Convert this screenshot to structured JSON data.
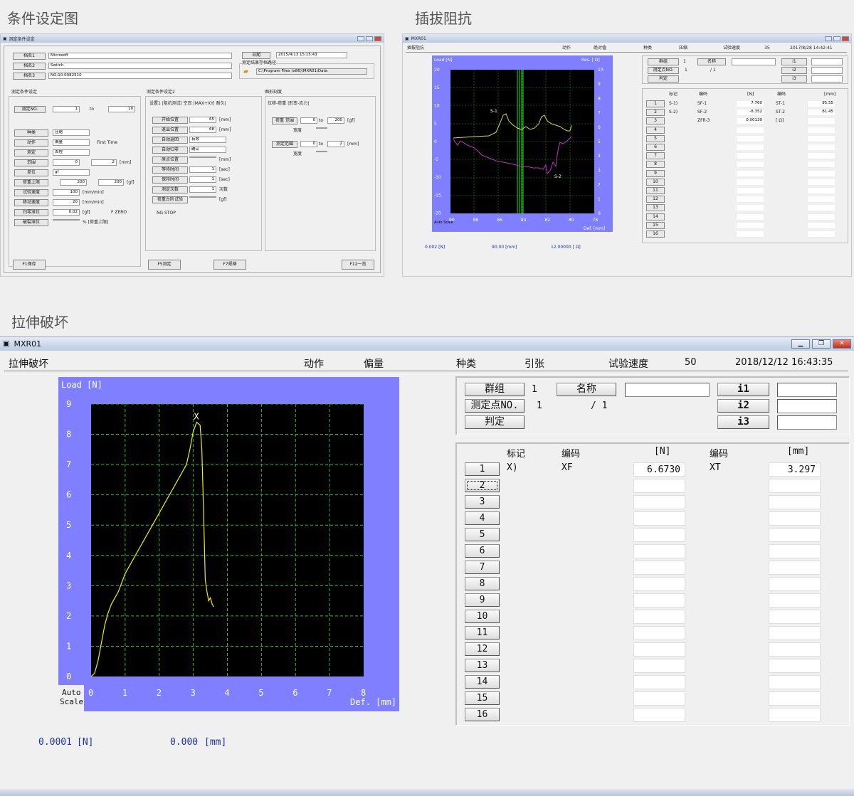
{
  "sections": {
    "top_left_title": "条件设定图",
    "top_right_title": "插拔阻抗",
    "bottom_title": "拉伸破坏"
  },
  "cond_window": {
    "title": "测定条件设定",
    "fields": [
      {
        "label": "档名1",
        "value": "Microsoft"
      },
      {
        "label": "档名2",
        "value": "Switch"
      },
      {
        "label": "档名3",
        "value": "NO:10-0082510"
      }
    ],
    "date_label": "日期",
    "date_value": "2015/4/13 15:15:43",
    "path_group": "测定结果存档路径",
    "path_value": "C:\\Program Files (x86)\\MXR01\\Data",
    "group1": "测定条件设定",
    "no_label": "测定NO.",
    "no_from": "1",
    "no_to_label": "to",
    "no_to": "10",
    "rows": [
      {
        "label": "种类",
        "value": "压缩"
      },
      {
        "label": "动作",
        "value": "偏量"
      },
      {
        "label": "测定",
        "value": "去程"
      },
      {
        "label": "范围",
        "value": "0"
      },
      {
        "label": "单位",
        "value": "gf"
      },
      {
        "label": "荷重上限",
        "value": "200"
      },
      {
        "label": "试验速度",
        "value": "100"
      },
      {
        "label": "移动速度",
        "value": "20"
      },
      {
        "label": "归零准位",
        "value": "0.02"
      },
      {
        "label": "破裂准位",
        "value": ""
      }
    ],
    "first_time": "First Time",
    "range_to": "2",
    "unit_mm": "[mm]",
    "upper_r": "200",
    "unit_gf": "[gf]",
    "speed_unit": "[mm/min]",
    "fzero": "F ZERO",
    "break_unit": "% [荷重上限]",
    "group2": "测定条件设定2",
    "tabs": "设置1 |阻抗测试| 空压 |MAX+XY| 耐久|",
    "g2rows": [
      {
        "label": "开始位置",
        "value": "65",
        "unit": "[mm]"
      },
      {
        "label": "退出位置",
        "value": "68",
        "unit": "[mm]"
      },
      {
        "label": "自动返回",
        "value": "有效",
        "unit": ""
      },
      {
        "label": "自动归零",
        "value": "确认",
        "unit": ""
      },
      {
        "label": "原点位置",
        "value": "",
        "unit": "[mm]"
      },
      {
        "label": "等待时间",
        "value": "1",
        "unit": "[sec]"
      },
      {
        "label": "保持时间",
        "value": "1",
        "unit": "[sec]"
      },
      {
        "label": "测定次数",
        "value": "1",
        "unit": "次数"
      },
      {
        "label": "荷重台阶试验",
        "value": "",
        "unit": "[gf]"
      }
    ],
    "ng_stop": "NG STOP",
    "group3": "图形刻度",
    "g3tab": "位移-荷重 |形变-应力|",
    "load_range": "荷重 范围",
    "load_from": "0",
    "load_to": "200",
    "load_unit": "[gf]",
    "width_label": "宽度",
    "meas_range": "测定范围",
    "meas_from": "0",
    "meas_to": "2",
    "meas_unit": "[mm]",
    "buttons": [
      "F1保存",
      "F5测定",
      "F7规格",
      "F12一览"
    ]
  },
  "ins_window": {
    "title": "MXR01",
    "header": [
      "插拔阻抗",
      "动作",
      "绝对值",
      "种类",
      "压缩",
      "试验速度",
      "35",
      "2017/8/28 14:42:41"
    ],
    "y_left": [
      "20",
      "15",
      "10",
      "5",
      "0",
      "-5",
      "-10",
      "-15",
      "-20"
    ],
    "y_right": [
      "10",
      "9",
      "8",
      "7",
      "6",
      "5",
      "4",
      "3",
      "2",
      "1",
      "0"
    ],
    "x_ticks": [
      "90",
      "88",
      "86",
      "84",
      "82",
      "80",
      "78"
    ],
    "load_label": "Load [N]",
    "res_label": "Res. [ Ω]",
    "def_label": "Def. [mm]",
    "auto_scale": "Auto Scale",
    "markers": [
      "S-1",
      "S-2"
    ],
    "foot": [
      "0.002 [N]",
      "90.00 [mm]",
      "12.00000 [ Ω]"
    ],
    "group_label": "群组",
    "group_value": "1",
    "name_label": "名称",
    "point_label": "测定点NO.",
    "point_value": "1",
    "point_total": "/ 1",
    "judge_label": "判定",
    "i_labels": [
      "i1",
      "i2",
      "i3"
    ],
    "table_headers": [
      "标记",
      "编码",
      "[N]",
      "编码",
      "[mm]"
    ],
    "rows": [
      {
        "mark": "S-1)",
        "code1": "SF-1",
        "n": "7.760",
        "code2": "ST-1",
        "mm": "85.55"
      },
      {
        "mark": "S-2)",
        "code1": "SF-2",
        "n": "-8.352",
        "code2": "ST-2",
        "mm": "81.45"
      },
      {
        "mark": "",
        "code1": "ZFR-3",
        "n": "0.00139",
        "code2": "[ Ω]",
        "mm": ""
      }
    ],
    "row_nums": [
      "1",
      "2",
      "3",
      "4",
      "5",
      "6",
      "7",
      "8",
      "9",
      "10",
      "11",
      "12",
      "13",
      "14",
      "15",
      "16"
    ]
  },
  "tensile_window": {
    "title": "MXR01",
    "header": {
      "name": "拉伸破坏",
      "action_label": "动作",
      "action_value": "偏量",
      "kind_label": "种类",
      "kind_value": "引张",
      "speed_label": "试验速度",
      "speed_value": "50",
      "datetime": "2018/12/12 16:43:35"
    },
    "chart_labels": {
      "load": "Load [N]",
      "def": "Def. [mm]",
      "auto": "Auto",
      "scale": "Scale",
      "marker": "X"
    },
    "info": {
      "group_label": "群组",
      "group_value": "1",
      "name_label": "名称",
      "point_label": "测定点NO.",
      "point_value": "1",
      "point_total": "/ 1",
      "judge_label": "判定",
      "i1": "i1",
      "i2": "i2",
      "i3": "i3"
    },
    "table": {
      "headers": [
        "标记",
        "编码",
        "[N]",
        "编码",
        "[mm]"
      ],
      "row1": {
        "mark": "X)",
        "code1": "XF",
        "n": "6.6730",
        "code2": "XT",
        "mm": "3.297"
      },
      "row_nums": [
        "1",
        "2",
        "3",
        "4",
        "5",
        "6",
        "7",
        "8",
        "9",
        "10",
        "11",
        "12",
        "13",
        "14",
        "15",
        "16"
      ]
    },
    "footer": {
      "load": "0.0001",
      "load_unit": "[N]",
      "def": "0.000",
      "def_unit": "[mm]"
    }
  },
  "chart_data": {
    "type": "line",
    "title": "",
    "xlabel": "Def. [mm]",
    "ylabel": "Load [N]",
    "xlim": [
      0,
      8
    ],
    "ylim": [
      0,
      9
    ],
    "x_ticks": [
      "0",
      "1",
      "2",
      "3",
      "4",
      "5",
      "6",
      "7",
      "8"
    ],
    "y_ticks": [
      "0",
      "1",
      "2",
      "3",
      "4",
      "5",
      "6",
      "7",
      "8",
      "9"
    ],
    "grid": true,
    "colors": {
      "line": "#f0f000",
      "grid": "#22c422",
      "plot_bg": "#000000",
      "frame": "#7f7fff"
    },
    "series": [
      {
        "x": [
          0,
          0.1,
          0.2,
          0.3,
          0.4,
          0.5,
          0.6,
          0.7,
          0.8,
          0.9,
          1.0,
          1.2,
          1.4,
          1.6,
          1.8,
          2.0,
          2.2,
          2.4,
          2.6,
          2.8,
          2.9,
          3.0,
          3.1,
          3.2,
          3.25,
          3.3,
          3.35,
          3.4,
          3.45,
          3.5,
          3.55,
          3.6
        ],
        "y": [
          0,
          0.1,
          0.5,
          1.1,
          1.7,
          2.1,
          2.4,
          2.6,
          2.8,
          3.1,
          3.4,
          3.8,
          4.2,
          4.6,
          5.0,
          5.4,
          5.8,
          6.2,
          6.6,
          7.0,
          7.5,
          8.1,
          8.4,
          8.3,
          7.5,
          5.5,
          3.2,
          2.8,
          2.5,
          2.6,
          2.4,
          2.3
        ]
      }
    ]
  },
  "colors": {
    "accent": "#1f2fa8",
    "chart_frame": "#7f7fff",
    "title_bar": "#c6d5ea"
  }
}
